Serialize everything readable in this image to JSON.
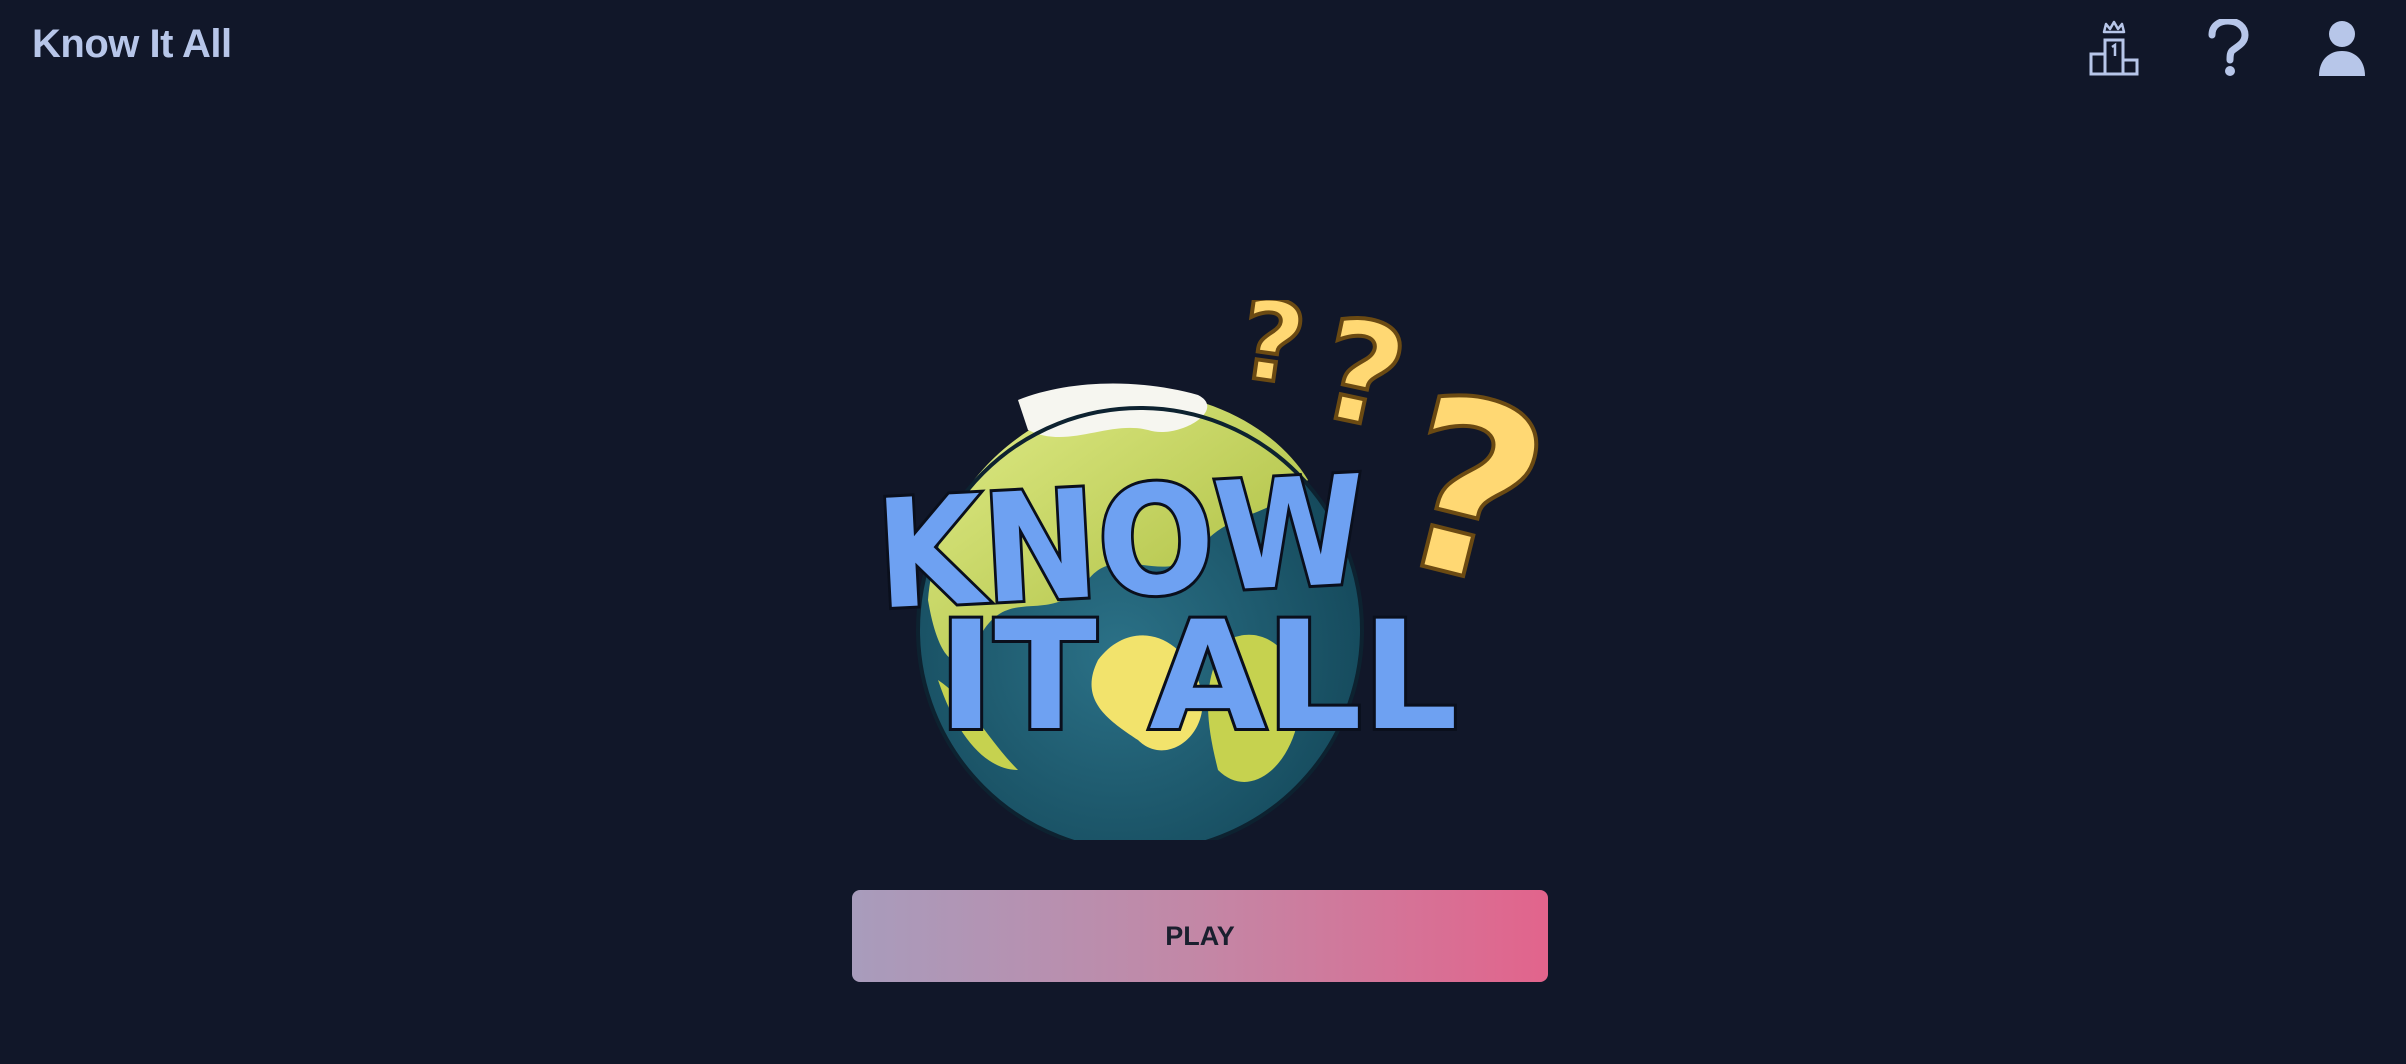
{
  "header": {
    "title": "Know It All",
    "nav": [
      {
        "icon": "leaderboard-icon"
      },
      {
        "icon": "help-icon"
      },
      {
        "icon": "profile-icon"
      }
    ]
  },
  "logo": {
    "text_line1": "KNOW",
    "text_line2": "IT ALL"
  },
  "main": {
    "play_label": "PLAY"
  },
  "colors": {
    "background": "#111729",
    "title": "#b7c6e9",
    "logo_letters": "#6ea1f2",
    "question_marks": "#ffd873",
    "button_gradient_start": "#a89cbc",
    "button_gradient_end": "#e2648c"
  }
}
